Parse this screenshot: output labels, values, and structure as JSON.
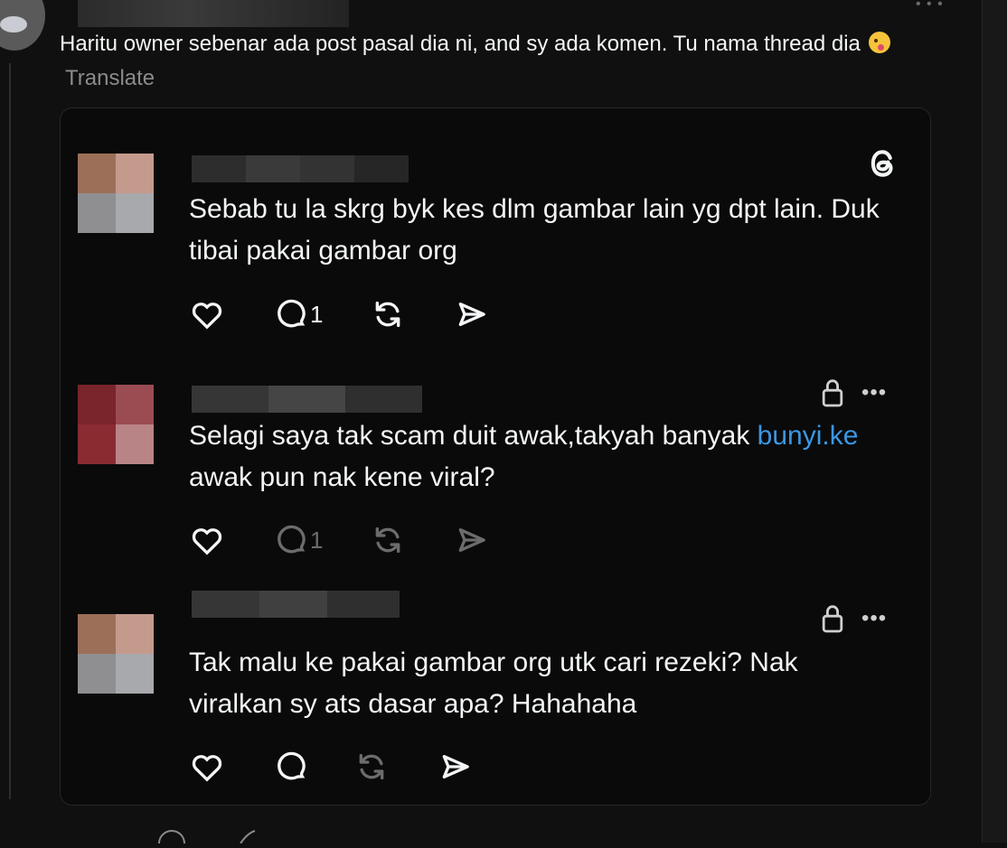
{
  "post": {
    "text": "Haritu owner sebenar ada post pasal dia ni, and sy ada komen. Tu nama thread dia",
    "translate": "Translate"
  },
  "replies": [
    {
      "text": "Sebab tu la skrg byk kes dlm gambar lain yg dpt lain. Duk tibai pakai gambar org",
      "reply_count": "1",
      "locked": false,
      "show_threads_logo": true
    },
    {
      "text_before_link": "Selagi saya tak scam duit awak,takyah banyak ",
      "link_text": "bunyi.ke",
      "text_after_link": " awak pun nak kene viral?",
      "reply_count": "1",
      "locked": true
    },
    {
      "text": "Tak malu ke pakai gambar org utk cari rezeki? Nak viralkan sy ats dasar apa? Hahahaha",
      "reply_count": "",
      "locked": true
    }
  ],
  "icons": [
    "heart-icon",
    "comment-icon",
    "repost-icon",
    "share-icon",
    "lock-icon",
    "more-icon",
    "threads-logo-icon"
  ],
  "colors": {
    "background": "#101010",
    "card": "#0a0a0a",
    "text": "#f3f5f7",
    "muted": "#8b8b8b",
    "link": "#3b97e3"
  }
}
